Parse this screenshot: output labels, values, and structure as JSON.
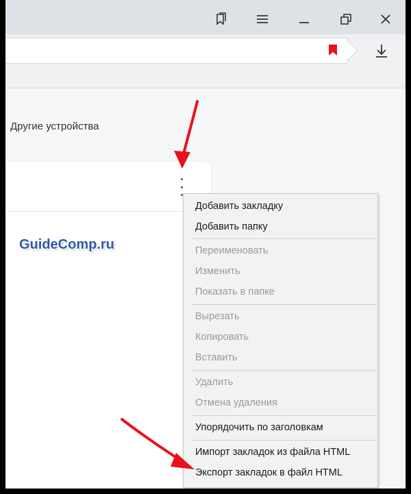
{
  "content": {
    "devices_label": "Другие устройства",
    "watermark": "GuideComp.ru"
  },
  "titlebar": {
    "icons": [
      "bookmarks-panel-icon",
      "menu-icon",
      "minimize-icon",
      "restore-icon",
      "close-icon"
    ]
  },
  "addressbar": {
    "icons": [
      "bookmark-flag-icon",
      "download-icon"
    ]
  },
  "context_menu": {
    "items": [
      {
        "label": "Добавить закладку",
        "enabled": true
      },
      {
        "label": "Добавить папку",
        "enabled": true
      },
      {
        "label": "Переименовать",
        "enabled": false
      },
      {
        "label": "Изменить",
        "enabled": false
      },
      {
        "label": "Показать в папке",
        "enabled": false
      },
      {
        "label": "Вырезать",
        "enabled": false
      },
      {
        "label": "Копировать",
        "enabled": false
      },
      {
        "label": "Вставить",
        "enabled": false
      },
      {
        "label": "Удалить",
        "enabled": false
      },
      {
        "label": "Отмена удаления",
        "enabled": false
      },
      {
        "label": "Упорядочить по заголовкам",
        "enabled": true
      },
      {
        "label": "Импорт закладок из файла HTML",
        "enabled": true
      },
      {
        "label": "Экспорт закладок в файл HTML",
        "enabled": true
      }
    ]
  },
  "colors": {
    "arrow": "#e8121a",
    "bookmark_flag": "#e8121a",
    "watermark": "#2c5aa6"
  }
}
